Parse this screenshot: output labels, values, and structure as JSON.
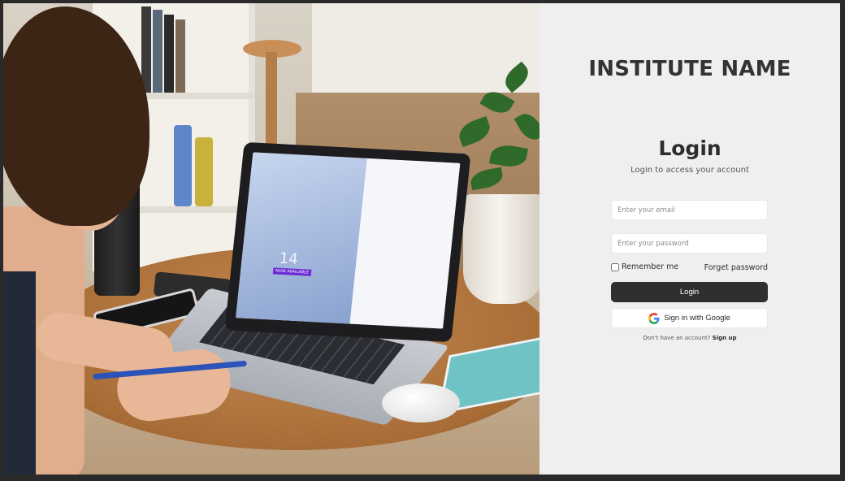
{
  "brand": {
    "institute_name": "INSTITUTE NAME"
  },
  "login": {
    "title": "Login",
    "subtitle": "Login to access your  account",
    "email_placeholder": "Enter your email",
    "password_placeholder": "Enter your password",
    "remember_label": "Remember me",
    "forget_label": "Forget password",
    "login_button": "Login",
    "google_button": "Sign in with Google",
    "signup_prompt": "Don't have an account?",
    "signup_link": "Sign up"
  },
  "colors": {
    "panel_bg": "#efefef",
    "primary_button": "#2f2f2f",
    "text_dark": "#333333"
  },
  "icons": {
    "google": "google-g-icon"
  },
  "image": {
    "screen_text_main": "NOW AVAILABLE",
    "screen_text_sub": "14"
  }
}
